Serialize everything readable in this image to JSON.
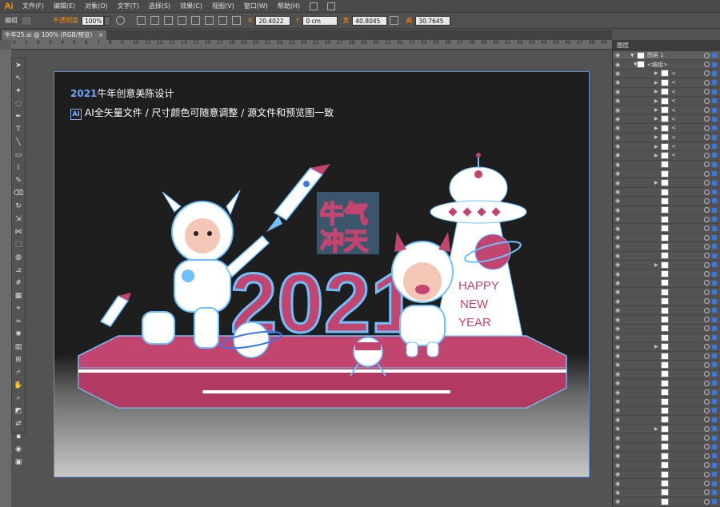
{
  "menubar": {
    "logo": "Ai",
    "items": [
      "文件(F)",
      "编辑(E)",
      "对象(O)",
      "文字(T)",
      "选择(S)",
      "效果(C)",
      "视图(V)",
      "窗口(W)",
      "帮助(H)"
    ]
  },
  "controlbar": {
    "mode_label": "编组",
    "opacity_label": "不透明度",
    "opacity_value": "100%",
    "x_label": "X",
    "x_value": "20.4022",
    "y_label": "Y",
    "y_value": "0 cm",
    "w_label": "宽",
    "w_value": "40.8045",
    "h_label": "高",
    "h_value": "30.7645"
  },
  "document_tab": {
    "title": "牛年25.ai @ 100% (RGB/预览)",
    "close": "×"
  },
  "ruler": {
    "top_numbers": [
      "0",
      "1",
      "2",
      "3",
      "4",
      "5",
      "6",
      "7",
      "8",
      "9",
      "10",
      "11",
      "12",
      "13",
      "14",
      "15",
      "16",
      "17",
      "18",
      "19",
      "20",
      "21",
      "22",
      "23",
      "24",
      "25",
      "26",
      "27",
      "28",
      "29",
      "30",
      "31",
      "32",
      "33",
      "34",
      "35",
      "36",
      "37",
      "38",
      "39",
      "40",
      "41",
      "42",
      "43",
      "44",
      "45",
      "46",
      "47",
      "48",
      "49",
      "50"
    ]
  },
  "artboard": {
    "title_year": "2021",
    "title_rest": "牛年创意美陈设计",
    "badge": "AI",
    "subtitle": "AI全矢量文件 / 尺寸颜色可随意调整 / 源文件和预览图一致",
    "big_number": "2021",
    "headline": "牛气冲天",
    "greeting_lines": [
      "HAPPY",
      "NEW",
      "YEAR"
    ]
  },
  "layers_panel": {
    "tab": "图层",
    "top_layer": "图层 1",
    "group_label": "<编组>",
    "row_label": "<",
    "row_count": 48
  },
  "colors": {
    "accent": "#ff8a00",
    "selection": "#3b78e7",
    "stage_pink": "#c2456f",
    "art_blue": "#5b8bd8"
  }
}
